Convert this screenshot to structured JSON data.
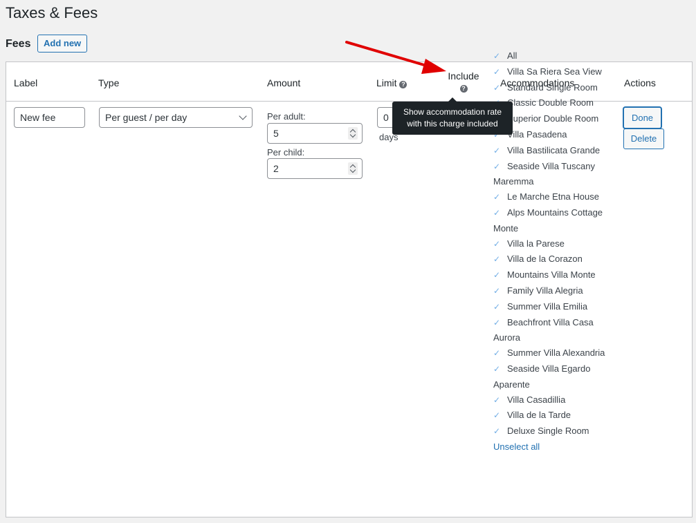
{
  "page": {
    "title": "Taxes & Fees"
  },
  "fees": {
    "section_title": "Fees",
    "add_new_label": "Add new",
    "columns": {
      "label": "Label",
      "type": "Type",
      "amount": "Amount",
      "limit": "Limit",
      "include": "Include",
      "accommodations": "Accommodations",
      "actions": "Actions"
    },
    "row": {
      "label_value": "New fee",
      "type_value": "Per guest / per day",
      "per_adult_label": "Per adult:",
      "per_adult_value": "5",
      "per_child_label": "Per child:",
      "per_child_value": "2",
      "limit_value": "0",
      "limit_unit": "days",
      "accommodations": [
        "All",
        "Villa Sa Riera Sea View",
        "Standard Single Room",
        "Classic Double Room",
        "Superior Double Room",
        "Villa Pasadena",
        "Villa Bastilicata Grande",
        "Seaside Villa Tuscany Maremma",
        "Le Marche Etna House",
        "Alps Mountains Cottage Monte",
        "Villa la Parese",
        "Villa de la Corazon",
        "Mountains Villa Monte",
        "Family Villa Alegria",
        "Summer Villa Emilia",
        "Beachfront Villa Casa Aurora",
        "Summer Villa Alexandria",
        "Seaside Villa Egardo Aparente",
        "Villa Casadillia",
        "Villa de la Tarde",
        "Deluxe Single Room"
      ],
      "unselect_all_label": "Unselect all",
      "done_label": "Done",
      "delete_label": "Delete"
    },
    "tooltip": {
      "line1": "Show accommodation rate",
      "line2": "with this charge included"
    },
    "help_glyph": "?",
    "check_glyph": "✓"
  },
  "colors": {
    "accent": "#2271b1",
    "annotation_arrow": "#e00000",
    "tooltip_bg": "#1d2327"
  }
}
